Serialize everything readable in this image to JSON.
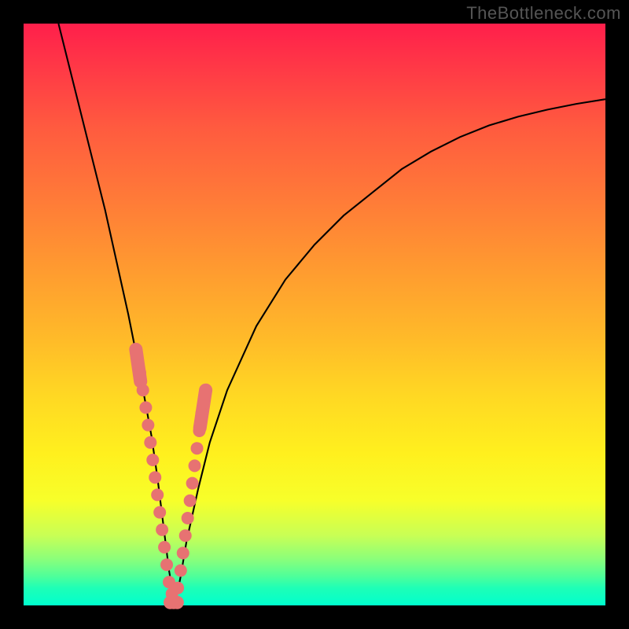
{
  "watermark": "TheBottleneck.com",
  "chart_data": {
    "type": "line",
    "title": "",
    "xlabel": "",
    "ylabel": "",
    "xlim": [
      0,
      100
    ],
    "ylim": [
      0,
      100
    ],
    "grid": false,
    "legend": false,
    "background_gradient": {
      "top": "#ff1f4b",
      "bottom": "#00ffce",
      "description": "vertical red-to-green gradient indicating bottleneck severity (top=high, bottom=low)"
    },
    "series": [
      {
        "name": "bottleneck-curve",
        "description": "V-shaped bottleneck curve; valley marks optimal balance point",
        "x": [
          6,
          8,
          10,
          12,
          14,
          16,
          18,
          20,
          22,
          23,
          24,
          25,
          26,
          27,
          28,
          30,
          32,
          35,
          40,
          45,
          50,
          55,
          60,
          65,
          70,
          75,
          80,
          85,
          90,
          95,
          100
        ],
        "values": [
          100,
          92,
          84,
          76,
          68,
          59,
          50,
          40,
          29,
          22,
          14,
          6,
          0,
          5,
          11,
          20,
          28,
          37,
          48,
          56,
          62,
          67,
          71,
          75,
          78,
          80.5,
          82.5,
          84,
          85.2,
          86.2,
          87
        ]
      }
    ],
    "markers": {
      "description": "pink data points clustered near valley on both arms",
      "left_arm": [
        {
          "x": 20,
          "y": 40
        },
        {
          "x": 20.5,
          "y": 37
        },
        {
          "x": 21,
          "y": 34
        },
        {
          "x": 21.4,
          "y": 31
        },
        {
          "x": 21.8,
          "y": 28
        },
        {
          "x": 22.2,
          "y": 25
        },
        {
          "x": 22.6,
          "y": 22
        },
        {
          "x": 23,
          "y": 19
        },
        {
          "x": 23.4,
          "y": 16
        },
        {
          "x": 23.8,
          "y": 13
        },
        {
          "x": 24.2,
          "y": 10
        },
        {
          "x": 24.6,
          "y": 7
        },
        {
          "x": 25,
          "y": 4
        },
        {
          "x": 25.5,
          "y": 2
        }
      ],
      "right_arm": [
        {
          "x": 26.5,
          "y": 3
        },
        {
          "x": 27,
          "y": 6
        },
        {
          "x": 27.4,
          "y": 9
        },
        {
          "x": 27.8,
          "y": 12
        },
        {
          "x": 28.2,
          "y": 15
        },
        {
          "x": 28.6,
          "y": 18
        },
        {
          "x": 29,
          "y": 21
        },
        {
          "x": 29.4,
          "y": 24
        },
        {
          "x": 29.8,
          "y": 27
        },
        {
          "x": 30.2,
          "y": 30
        },
        {
          "x": 30.6,
          "y": 33
        }
      ],
      "bottom": [
        {
          "x": 25.2,
          "y": 0.5
        },
        {
          "x": 25.8,
          "y": 0.5
        },
        {
          "x": 26.4,
          "y": 0.5
        }
      ]
    },
    "long_markers": {
      "description": "elongated pink markers (rounded capsules) at ends of dot clusters",
      "items": [
        {
          "arm": "left",
          "x1": 19.3,
          "y1": 44,
          "x2": 20.1,
          "y2": 38.5
        },
        {
          "arm": "right",
          "x1": 30.3,
          "y1": 30.5,
          "x2": 31.3,
          "y2": 37
        }
      ]
    }
  }
}
